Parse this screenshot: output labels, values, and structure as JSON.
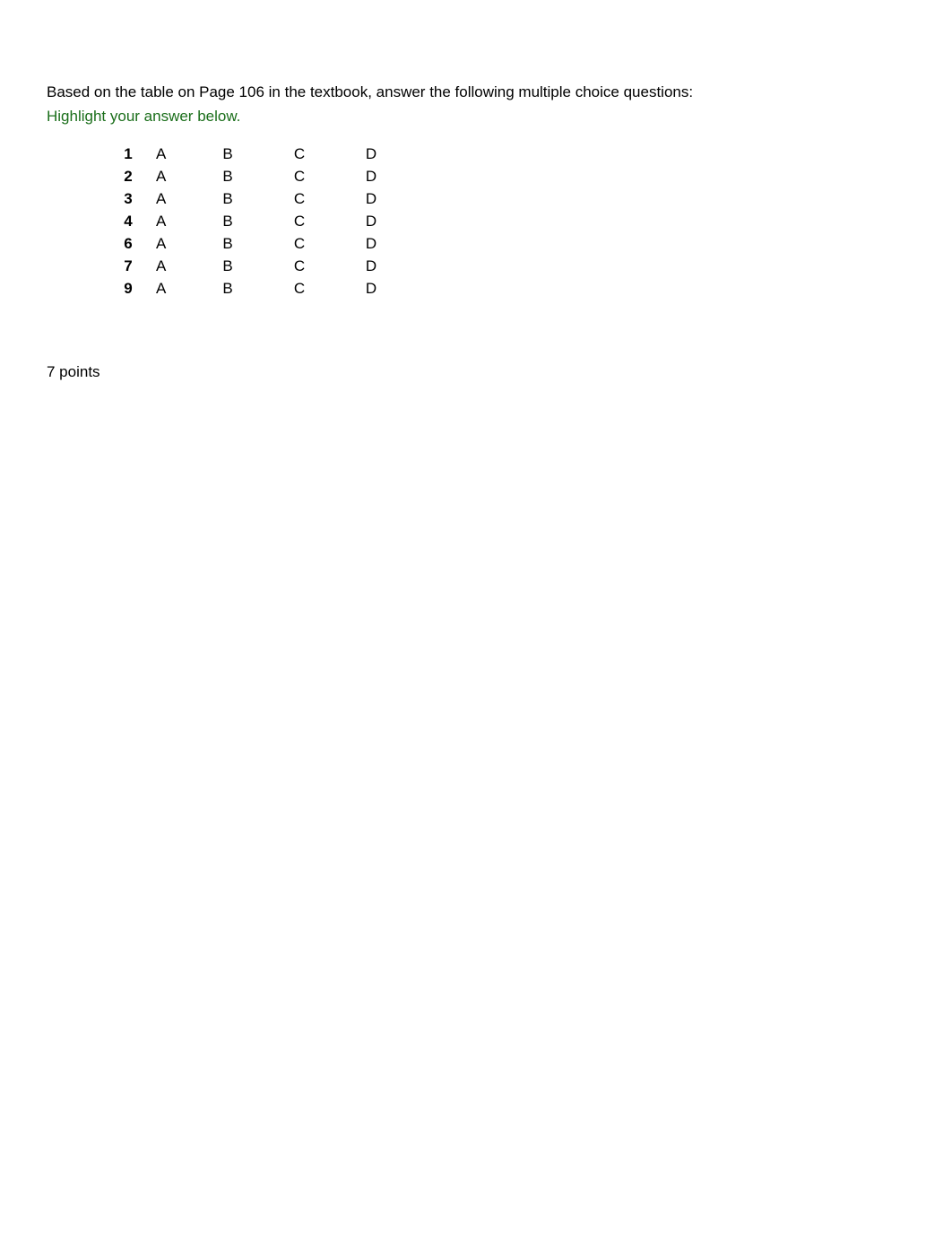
{
  "instruction": "Based on the table on Page 106 in the textbook, answer the following multiple choice questions:",
  "highlight": "Highlight your answer below.",
  "rows": [
    {
      "num": "1",
      "a": "A",
      "b": "B",
      "c": "C",
      "d": "D"
    },
    {
      "num": "2",
      "a": "A",
      "b": "B",
      "c": "C",
      "d": "D"
    },
    {
      "num": "3",
      "a": "A",
      "b": "B",
      "c": "C",
      "d": "D"
    },
    {
      "num": "4",
      "a": "A",
      "b": "B",
      "c": "C",
      "d": "D"
    },
    {
      "num": "6",
      "a": "A",
      "b": "B",
      "c": "C",
      "d": "D"
    },
    {
      "num": "7",
      "a": "A",
      "b": "B",
      "c": "C",
      "d": "D"
    },
    {
      "num": "9",
      "a": "A",
      "b": "B",
      "c": "C",
      "d": "D"
    }
  ],
  "points": "7 points"
}
